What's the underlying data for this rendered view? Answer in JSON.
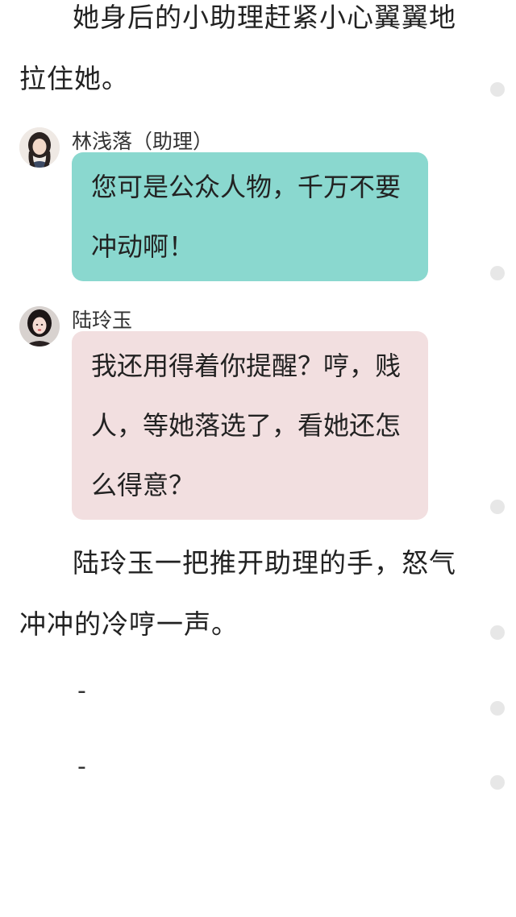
{
  "paragraphs": {
    "p1": "她身后的小助理赶紧小心翼翼地拉住她。",
    "p2": "陆玲玉一把推开助理的手，怒气冲冲的冷哼一声。"
  },
  "messages": [
    {
      "sender": "林浅落（助理）",
      "text": "您可是公众人物，千万不要冲动啊！",
      "bubble_color": "#8ad8cf"
    },
    {
      "sender": "陆玲玉",
      "text": "我还用得着你提醒？哼，贱人，等她落选了，看她还怎么得意？",
      "bubble_color": "#f2dfe0"
    }
  ],
  "separators": [
    "-",
    "-"
  ],
  "colors": {
    "background": "#ffffff",
    "text": "#222222",
    "scroll_dot": "#e7e7e7"
  }
}
